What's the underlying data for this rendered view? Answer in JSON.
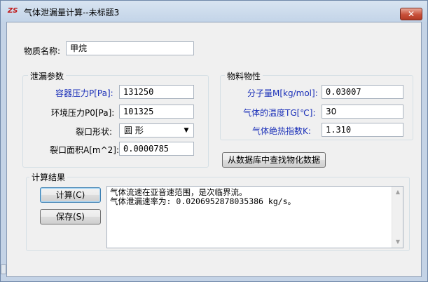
{
  "window": {
    "title": "气体泄漏量计算--未标题3",
    "close_glyph": "✕",
    "icon_glyph": "ZS"
  },
  "substance": {
    "label": "物质名称:",
    "value": "甲烷"
  },
  "leak_params": {
    "title": "泄漏参数",
    "vessel_pressure": {
      "label": "容器压力P[Pa]:",
      "value": "131250"
    },
    "ambient_pressure": {
      "label": "环境压力P0[Pa]:",
      "value": "101325"
    },
    "crack_shape": {
      "label": "裂口形状:",
      "value": "圆  形"
    },
    "crack_area": {
      "label": "裂口面积A[m^2]:",
      "value": "0.0000785"
    }
  },
  "material_props": {
    "title": "物料物性",
    "molecular_weight": {
      "label": "分子量M[kg/mol]:",
      "value": "0.03007"
    },
    "gas_temperature": {
      "label": "气体的温度TG[℃]:",
      "value": "30"
    },
    "adiabatic_index": {
      "label": "气体绝热指数K:",
      "value": "1.310"
    },
    "db_lookup_button": "从数据库中查找物化数据"
  },
  "results": {
    "title": "计算结果",
    "calc_button": "计算(C)",
    "save_button": "保存(S)",
    "output": "气体流速在亚音速范围，是次临界流。\n气体泄漏速率为: 0.0206952878035386 kg/s。"
  },
  "colors": {
    "title_blue_label": "#1a2fb8",
    "close_red": "#c8503a"
  }
}
